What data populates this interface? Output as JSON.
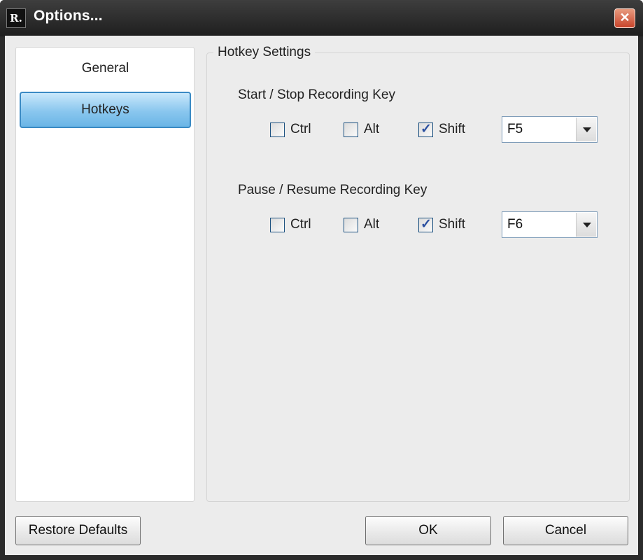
{
  "window": {
    "title": "Options...",
    "app_icon_text": "R.",
    "close_glyph": "✕"
  },
  "nav": {
    "items": [
      {
        "label": "General"
      },
      {
        "label": "Hotkeys"
      }
    ],
    "selected": "Hotkeys"
  },
  "hotkey_settings": {
    "title": "Hotkey Settings",
    "sections": [
      {
        "label": "Start / Stop Recording Key",
        "modifiers": [
          {
            "label": "Ctrl",
            "checked": false
          },
          {
            "label": "Alt",
            "checked": false
          },
          {
            "label": "Shift",
            "checked": true
          }
        ],
        "key": "F5"
      },
      {
        "label": "Pause / Resume Recording Key",
        "modifiers": [
          {
            "label": "Ctrl",
            "checked": false
          },
          {
            "label": "Alt",
            "checked": false
          },
          {
            "label": "Shift",
            "checked": true
          }
        ],
        "key": "F6"
      }
    ]
  },
  "buttons": {
    "restore_defaults": "Restore Defaults",
    "ok": "OK",
    "cancel": "Cancel"
  },
  "colors": {
    "selected_item": "#89c6ee",
    "close_button": "#c8442b",
    "title_bar": "#2b2b2b"
  }
}
